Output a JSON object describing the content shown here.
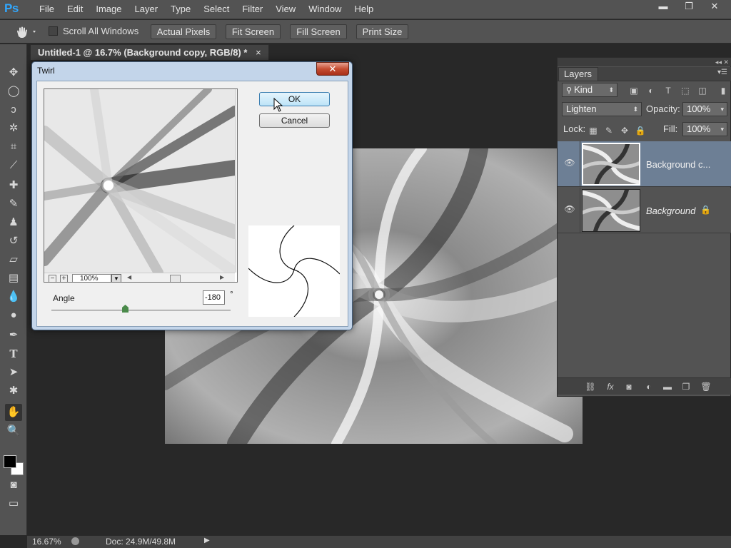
{
  "app": {
    "logo": "Ps"
  },
  "menu": [
    "File",
    "Edit",
    "Image",
    "Layer",
    "Type",
    "Select",
    "Filter",
    "View",
    "Window",
    "Help"
  ],
  "window_controls": {
    "minimize": "▬",
    "restore": "❐",
    "close": "✕"
  },
  "options_bar": {
    "scroll_all_windows": "Scroll All Windows",
    "scroll_all_checked": false,
    "actual_pixels": "Actual Pixels",
    "fit_screen": "Fit Screen",
    "fill_screen": "Fill Screen",
    "print_size": "Print Size"
  },
  "document": {
    "tab_title": "Untitled-1 @ 16.7% (Background copy, RGB/8) *",
    "tab_close": "×"
  },
  "status": {
    "zoom": "16.67%",
    "doc": "Doc: 24.9M/49.8M"
  },
  "twirl_dialog": {
    "title": "Twirl",
    "close": "✕",
    "ok": "OK",
    "cancel": "Cancel",
    "preview_zoom": "100%",
    "zoom_out": "−",
    "zoom_in": "+",
    "angle_label": "Angle",
    "angle_value": "-180",
    "angle_unit": "°",
    "angle_min": -999,
    "angle_max": 999
  },
  "layers_panel": {
    "tab": "Layers",
    "kind": "Kind",
    "blend_mode": "Lighten",
    "opacity_label": "Opacity:",
    "opacity_value": "100%",
    "lock_label": "Lock:",
    "fill_label": "Fill:",
    "fill_value": "100%",
    "layers": [
      {
        "name": "Background c...",
        "selected": true,
        "locked": false
      },
      {
        "name": "Background",
        "selected": false,
        "locked": true
      }
    ]
  }
}
